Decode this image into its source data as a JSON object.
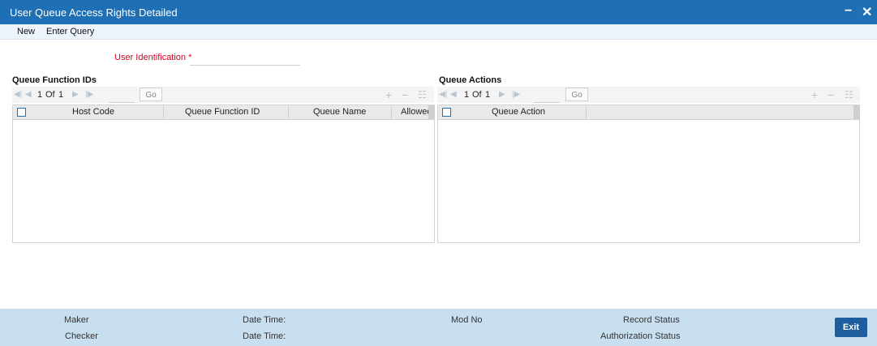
{
  "window": {
    "title": "User Queue Access Rights Detailed",
    "minimize": "−",
    "close": "✕"
  },
  "menu": {
    "new": "New",
    "enter_query": "Enter Query"
  },
  "user_identification": {
    "label": "User Identification",
    "required_marker": "*",
    "value": ""
  },
  "queue_function_ids": {
    "title": "Queue Function IDs",
    "pagination": {
      "current": "1",
      "of_label": "Of",
      "total": "1",
      "go": "Go"
    },
    "columns": [
      "Host Code",
      "Queue Function ID",
      "Queue Name",
      "Allowed"
    ],
    "rows": []
  },
  "queue_actions": {
    "title": "Queue Actions",
    "pagination": {
      "current": "1",
      "of_label": "Of",
      "total": "1",
      "go": "Go"
    },
    "columns": [
      "Queue Action"
    ],
    "rows": []
  },
  "icons": {
    "first": "first-page-icon",
    "prev": "prev-page-icon",
    "next": "next-page-icon",
    "last": "last-page-icon",
    "add": "plus-icon",
    "delete": "minus-icon",
    "single_view": "list-icon"
  },
  "footer": {
    "maker": "Maker",
    "checker": "Checker",
    "maker_date": "Date Time:",
    "checker_date": "Date Time:",
    "mod_no": "Mod No",
    "record_status": "Record Status",
    "auth_status": "Authorization Status",
    "exit": "Exit"
  },
  "colors": {
    "title_bar": "#1f6fb5",
    "footer": "#c8dff0",
    "required": "#d9001b",
    "exit_button": "#1f5e9e"
  }
}
